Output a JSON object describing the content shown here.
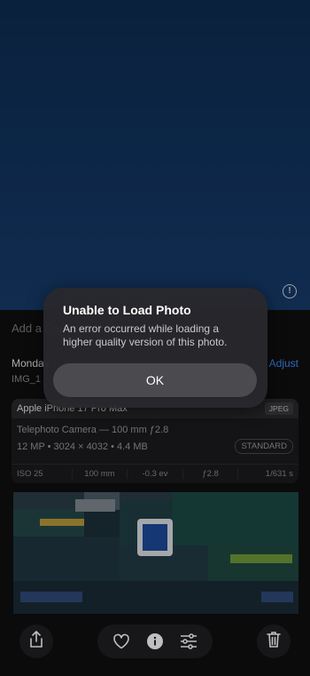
{
  "photo": {
    "info_badge": "!"
  },
  "details": {
    "caption_placeholder": "Add a Caption",
    "date": "Monday",
    "adjust_label": "Adjust",
    "filename": "IMG_1"
  },
  "metadata": {
    "device": "Apple iPhone 17 Pro Max",
    "format": "JPEG",
    "lens": "Telephoto Camera — 100 mm ƒ2.8",
    "specs": "12 MP • 3024 × 4032 • 4.4 MB",
    "profile": "STANDARD",
    "exif": [
      "ISO 25",
      "100 mm",
      "-0.3 ev",
      "ƒ2.8",
      "1/631 s"
    ]
  },
  "toolbar": {
    "share_icon": "share-icon",
    "favorite_icon": "heart-icon",
    "info_icon": "info-icon",
    "adjust_icon": "sliders-icon",
    "delete_icon": "trash-icon"
  },
  "alert": {
    "title": "Unable to Load Photo",
    "message": "An error occurred while loading a higher quality version of this photo.",
    "ok_label": "OK"
  },
  "colors": {
    "accent": "#3f8cff",
    "photo_top": "#0e2c52",
    "photo_bottom": "#173b6a"
  }
}
